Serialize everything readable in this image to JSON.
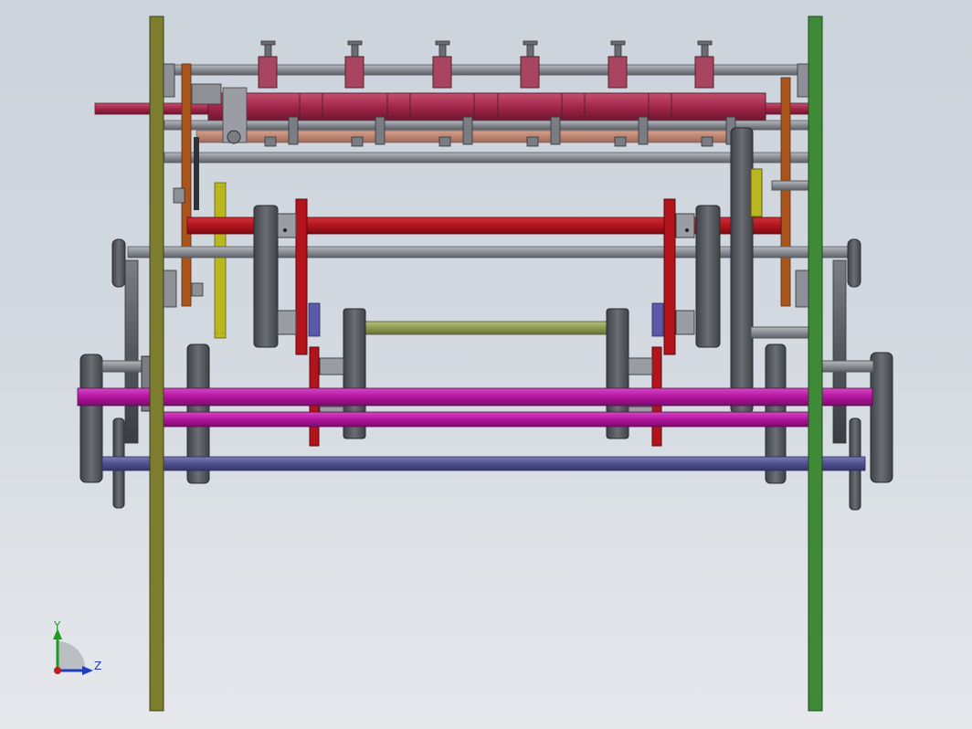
{
  "viewport": {
    "name": "cad-3d-viewport",
    "background_top": "#ccd3dc",
    "background_bottom": "#e6e8ec"
  },
  "triad": {
    "y_label": "Y",
    "z_label": "Z",
    "y_color": "#1f9a1f",
    "z_color": "#1f3fbf",
    "x_color": "#c02020"
  },
  "model": {
    "description_icon": "roller-frame-assembly-icon",
    "colors": {
      "left_side_plate": "#7c7d2e",
      "right_side_plate": "#3e8a37",
      "upper_roller": "#a8294a",
      "red_shaft": "#b3141c",
      "olive_shaft": "#8f9a4f",
      "magenta_shaft": "#b3149e",
      "blue_shaft": "#4f4f8f",
      "grey_rod": "#8d9096",
      "dark_part": "#55585e",
      "orange_bar": "#a8541a",
      "yellow_bar": "#b9b820"
    }
  }
}
